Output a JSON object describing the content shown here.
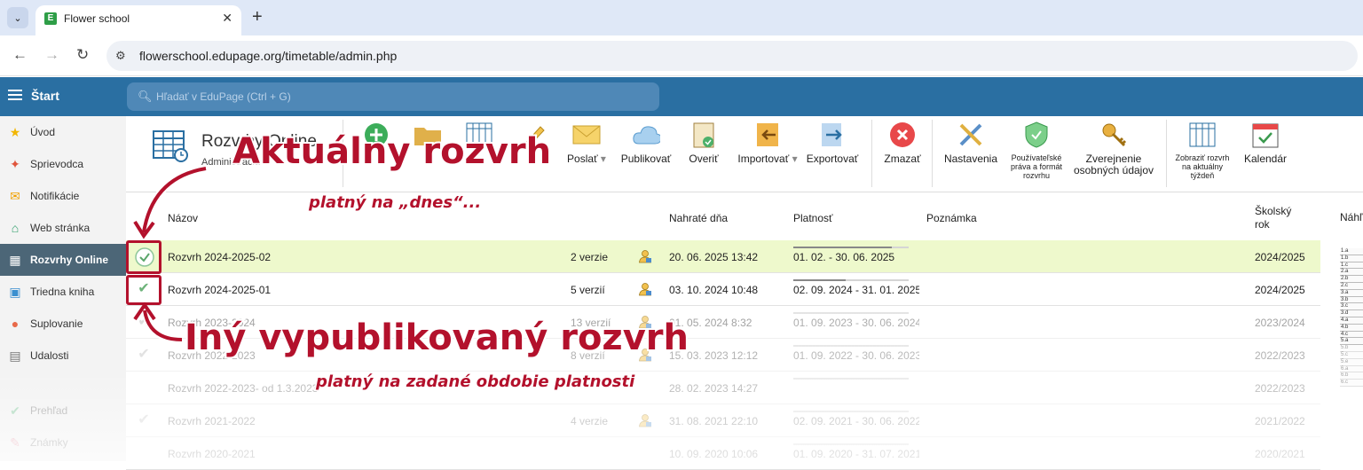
{
  "browser": {
    "tab_title": "Flower school",
    "tab_favicon": "E",
    "url": "flowerschool.edupage.org/timetable/admin.php"
  },
  "header": {
    "start_label": "Štart",
    "search_placeholder": "Hľadať v EduPage (Ctrl + G)"
  },
  "sidebar": {
    "items": [
      {
        "label": "Úvod",
        "icon": "star-icon",
        "color": "#f2b600"
      },
      {
        "label": "Sprievodca",
        "icon": "wand-icon",
        "color": "#e0553c"
      },
      {
        "label": "Notifikácie",
        "icon": "envelope-icon",
        "color": "#f0a000"
      },
      {
        "label": "Web stránka",
        "icon": "house-icon",
        "color": "#2e9e6a"
      },
      {
        "label": "Rozvrhy Online",
        "icon": "grid-icon",
        "color": "#ffffff"
      },
      {
        "label": "Triedna kniha",
        "icon": "book-icon",
        "color": "#3a8fd0"
      },
      {
        "label": "Suplovanie",
        "icon": "person-icon",
        "color": "#e86a4a"
      },
      {
        "label": "Udalosti",
        "icon": "calendar-icon",
        "color": "#777777"
      },
      {
        "label": "Prehľad",
        "icon": "check-circle-icon",
        "color": "#2eaa5a"
      },
      {
        "label": "Známky",
        "icon": "grade-icon",
        "color": "#e04060"
      }
    ]
  },
  "toolbar": {
    "app_title": "Rozvrhy Online",
    "app_subtitle": "Administrácia",
    "buttons": [
      {
        "label": "Poslať",
        "icon": "envelope-icon"
      },
      {
        "label": "Publikovať",
        "icon": "cloud-icon"
      },
      {
        "label": "Overiť",
        "icon": "clipboard-check-icon"
      },
      {
        "label": "Importovať",
        "icon": "import-icon"
      },
      {
        "label": "Exportovať",
        "icon": "export-icon"
      },
      {
        "label": "Zmazať",
        "icon": "delete-icon"
      },
      {
        "label": "Nastavenia",
        "icon": "tools-icon"
      },
      {
        "label": "Používateľské práva a formát rozvrhu",
        "icon": "shield-icon"
      },
      {
        "label": "Zverejnenie osobných údajov",
        "icon": "key-icon"
      },
      {
        "label": "Zobraziť rozvrh na aktuálny týždeň",
        "icon": "timetable-icon"
      },
      {
        "label": "Kalendár",
        "icon": "calendar-check-icon"
      }
    ]
  },
  "table": {
    "headers": {
      "name": "Názov",
      "uploaded": "Nahraté dňa",
      "validity": "Platnosť",
      "note": "Poznámka",
      "school_year": "Školský rok",
      "preview": "Náhľ"
    },
    "rows": [
      {
        "name": "Rozvrh 2024-2025-02",
        "versions": "2 verzie",
        "uploaded": "20. 06. 2025 13:42",
        "validity": "01. 02. - 30. 06. 2025",
        "school_year": "2024/2025",
        "progress": 0.85,
        "current": true,
        "checked": true
      },
      {
        "name": "Rozvrh 2024-2025-01",
        "versions": "5 verzií",
        "uploaded": "03. 10. 2024 10:48",
        "validity": "02. 09. 2024 - 31. 01. 2025",
        "school_year": "2024/2025",
        "progress": 0.45,
        "current": false,
        "checked": true
      },
      {
        "name": "Rozvrh 2023-2024",
        "versions": "13 verzií",
        "uploaded": "01. 05. 2024 8:32",
        "validity": "01. 09. 2023 - 30. 06. 2024",
        "school_year": "2023/2024",
        "progress": 0.0,
        "current": false,
        "checked": true
      },
      {
        "name": "Rozvrh 2022-2023",
        "versions": "8 verzií",
        "uploaded": "15. 03. 2023 12:12",
        "validity": "01. 09. 2022 - 30. 06. 2023",
        "school_year": "2022/2023",
        "progress": 0.0,
        "current": false,
        "checked": true
      },
      {
        "name": "Rozvrh 2022-2023- od 1.3.2023",
        "versions": "",
        "uploaded": "28. 02. 2023 14:27",
        "validity": "",
        "school_year": "2022/2023",
        "progress": 0.0,
        "current": false,
        "checked": false
      },
      {
        "name": "Rozvrh 2021-2022",
        "versions": "4 verzie",
        "uploaded": "31. 08. 2021 22:10",
        "validity": "02. 09. 2021 - 30. 06. 2022",
        "school_year": "2021/2022",
        "progress": 0.0,
        "current": false,
        "checked": true
      },
      {
        "name": "Rozvrh 2020-2021",
        "versions": "",
        "uploaded": "10. 09. 2020 10:06",
        "validity": "01. 09. 2020 - 31. 07. 2021",
        "school_year": "2020/2021",
        "progress": 0.0,
        "current": false,
        "checked": false
      }
    ]
  },
  "preview_rows": [
    "1.a",
    "1.b",
    "1.c",
    "2.a",
    "2.b",
    "2.c",
    "3.a",
    "3.b",
    "3.c",
    "3.d",
    "4.a",
    "4.b",
    "4.c",
    "5.a",
    "5.b",
    "5.c",
    "5.e",
    "6.a",
    "6.b",
    "6.c"
  ],
  "annotations": {
    "current_title": "Aktuálny rozvrh",
    "current_sub": "platný na „dnes“...",
    "other_title": "Iný vypublikovaný rozvrh",
    "other_sub": "platný na zadané obdobie platnosti",
    "color": "#b3112c"
  }
}
